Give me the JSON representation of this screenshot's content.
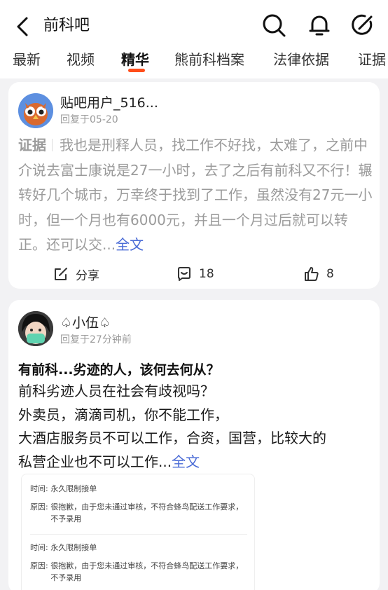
{
  "header": {
    "title": "前科吧",
    "tabs": [
      {
        "label": "最新",
        "active": false
      },
      {
        "label": "视频",
        "active": false
      },
      {
        "label": "精华",
        "active": true
      },
      {
        "label": "熊前科档案",
        "active": false
      },
      {
        "label": "法律依据",
        "active": false
      },
      {
        "label": "证据",
        "active": false
      }
    ],
    "icons": [
      "back-icon",
      "search-icon",
      "bell-icon",
      "compose-icon"
    ],
    "accent": "#ff4d1a"
  },
  "posts": [
    {
      "user": "贴吧用户_516...",
      "time": "回复于05-20",
      "tag": "证据",
      "content": "我也是刑释人员，找工作不好找，太难了，之前中介说去富士康说是27一小时，去了之后有前科又不行！辗转好几个城市，万幸终于找到了工作，虽然没有27元一小时，但一个月也有6000元，并且一个月过后就可以转正。还可以交...",
      "fulltext": "全文",
      "share": "分享",
      "comments": "18",
      "likes": "8"
    },
    {
      "user": "♤小伍♤",
      "time": "回复于27分钟前",
      "title": "有前科...劣迹的人，该何去何从？",
      "lines": [
        "前科劣迹人员在社会有歧视吗？",
        "外卖员，滴滴司机，你不能工作，",
        "大酒店服务员不可以工作，合资，国营，比较大的",
        "私营企业也不可以工作..."
      ],
      "fulltext": "全文",
      "notices": [
        {
          "time_label": "时间:",
          "time_value": "永久限制接单",
          "reason_label": "原因:",
          "reason_value": "很抱歉，由于您未通过审核，不符合蜂鸟配送工作要求，不予录用"
        },
        {
          "time_label": "时间:",
          "time_value": "永久限制接单",
          "reason_label": "原因:",
          "reason_value": "很抱歉，由于您未通过审核，不符合蜂鸟配送工作要求，不予录用"
        }
      ]
    }
  ]
}
